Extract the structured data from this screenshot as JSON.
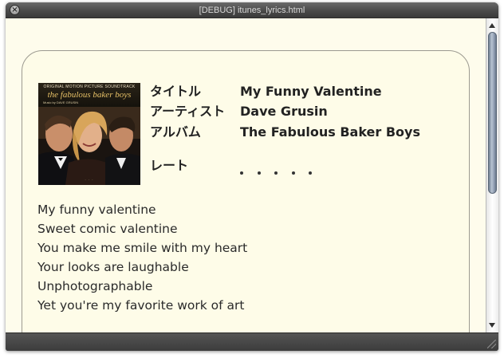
{
  "window": {
    "title": "[DEBUG] itunes_lyrics.html",
    "close_icon": "close-icon"
  },
  "track": {
    "labels": {
      "title": "タイトル",
      "artist": "アーティスト",
      "album": "アルバム",
      "rating": "レート"
    },
    "title": "My Funny Valentine",
    "artist": "Dave Grusin",
    "album": "The Fabulous Baker Boys",
    "rating_display": "・・・・・",
    "rating_value": 0,
    "rating_max": 5
  },
  "album_art": {
    "subtitle": "ORIGINAL MOTION PICTURE SOUNDTRACK",
    "title": "the fabulous baker boys",
    "credit": "Music by DAVE GRUSIN"
  },
  "lyrics": [
    "My funny valentine",
    "Sweet comic valentine",
    "You make me smile with my heart",
    "Your looks are laughable",
    "Unphotographable",
    "Yet you're my favorite work of art"
  ],
  "colors": {
    "content_background": "#fefcec",
    "panel_border": "#9c9a90",
    "text": "#222222",
    "chrome_dark": "#3f3f3f",
    "scroll_thumb": "#8e9bb0"
  }
}
